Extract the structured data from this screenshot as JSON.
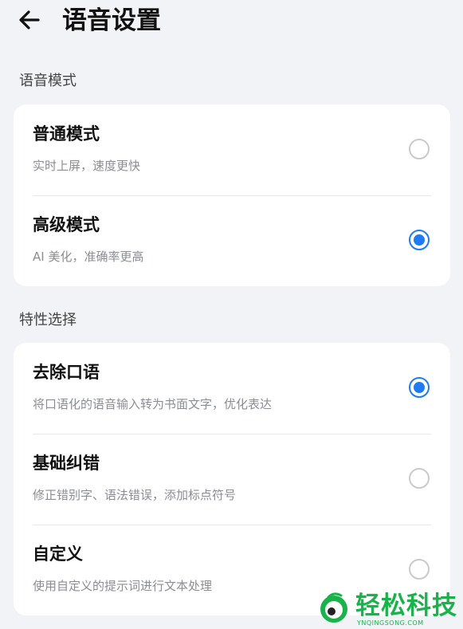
{
  "header": {
    "title": "语音设置",
    "back_icon": "arrow-left-icon"
  },
  "sections": [
    {
      "title": "语音模式",
      "items": [
        {
          "title": "普通模式",
          "desc": "实时上屏，速度更快",
          "selected": false
        },
        {
          "title": "高级模式",
          "desc": "AI 美化，准确率更高",
          "selected": true
        }
      ]
    },
    {
      "title": "特性选择",
      "items": [
        {
          "title": "去除口语",
          "desc": "将口语化的语音输入转为书面文字，优化表达",
          "selected": true
        },
        {
          "title": "基础纠错",
          "desc": "修正错别字、语法错误，添加标点符号",
          "selected": false
        },
        {
          "title": "自定义",
          "desc": "使用自定义的提示词进行文本处理",
          "selected": false
        }
      ]
    }
  ],
  "colors": {
    "accent": "#1f7bf2",
    "background": "#f1f3f7",
    "card": "#ffffff",
    "watermark": "#19b24b"
  },
  "watermark": {
    "name": "轻松科技",
    "url": "YNQINGSONG.COM"
  }
}
